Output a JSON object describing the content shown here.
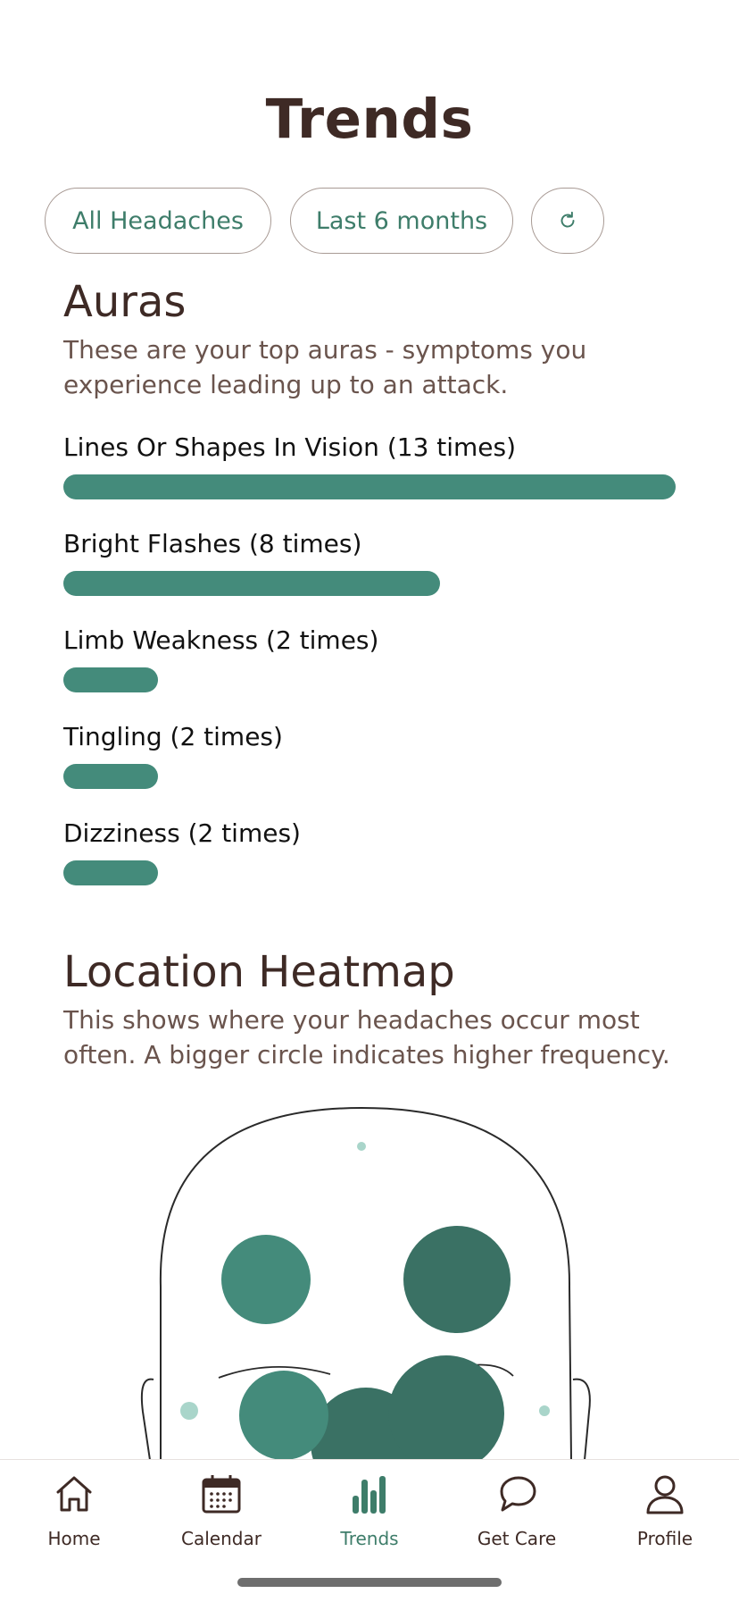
{
  "page": {
    "title": "Trends"
  },
  "filters": {
    "headache_type": "All Headaches",
    "period": "Last 6 months",
    "refresh_icon": "refresh-icon"
  },
  "auras": {
    "heading": "Auras",
    "description": "These are your top auras - symptoms you experience leading up to an attack.",
    "bar_color": "#448b7b",
    "items": [
      {
        "label": "Lines Or Shapes In Vision (13 times)",
        "count": 13
      },
      {
        "label": "Bright Flashes (8 times)",
        "count": 8
      },
      {
        "label": "Limb Weakness (2 times)",
        "count": 2
      },
      {
        "label": "Tingling (2 times)",
        "count": 2
      },
      {
        "label": "Dizziness (2 times)",
        "count": 2
      }
    ]
  },
  "heatmap": {
    "heading": "Location Heatmap",
    "description": "This shows where your headaches occur most often. A bigger circle indicates higher frequency.",
    "colors": {
      "low": "#a9d5ca",
      "mid": "#448b7b",
      "high": "#3a7164"
    }
  },
  "nav": {
    "items": [
      {
        "label": "Home",
        "icon": "home-icon"
      },
      {
        "label": "Calendar",
        "icon": "calendar-icon"
      },
      {
        "label": "Trends",
        "icon": "bar-chart-icon",
        "active": true
      },
      {
        "label": "Get Care",
        "icon": "chat-bubble-icon"
      },
      {
        "label": "Profile",
        "icon": "person-icon"
      }
    ],
    "active_color": "#3e7d6a",
    "default_color": "#3e2a25"
  }
}
